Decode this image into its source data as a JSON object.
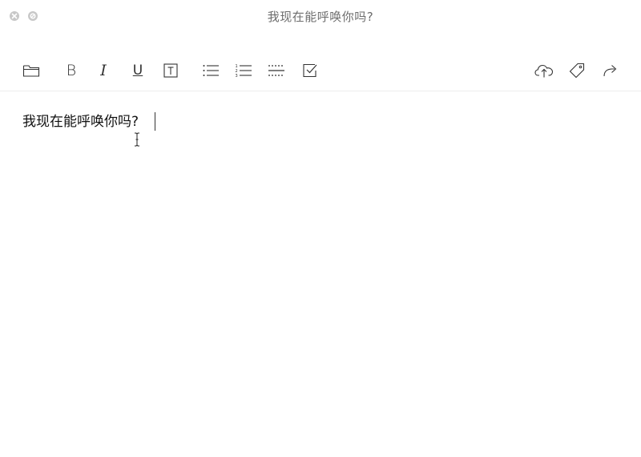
{
  "window": {
    "title": "我现在能呼唤你吗?"
  },
  "titlebar": {
    "close_button_icon": "close-icon",
    "minimize_button_icon": "minimize-icon"
  },
  "toolbar": {
    "items": [
      {
        "name": "folder",
        "icon": "folder-icon"
      },
      {
        "name": "bold",
        "label": "B",
        "icon": "bold-icon"
      },
      {
        "name": "italic",
        "label": "I",
        "icon": "italic-icon"
      },
      {
        "name": "underline",
        "label": "U",
        "icon": "underline-icon"
      },
      {
        "name": "text-box",
        "label": "T",
        "icon": "text-box-icon"
      },
      {
        "name": "bullet-list",
        "icon": "bullet-list-icon"
      },
      {
        "name": "numbered-list",
        "icon": "numbered-list-icon"
      },
      {
        "name": "separator",
        "icon": "dotted-separator-icon"
      },
      {
        "name": "checkbox",
        "icon": "checkbox-icon"
      },
      {
        "name": "upload",
        "icon": "cloud-upload-icon"
      },
      {
        "name": "tag",
        "icon": "tag-icon"
      },
      {
        "name": "share",
        "icon": "share-icon"
      }
    ]
  },
  "editor": {
    "content": "我现在能呼唤你吗?"
  }
}
